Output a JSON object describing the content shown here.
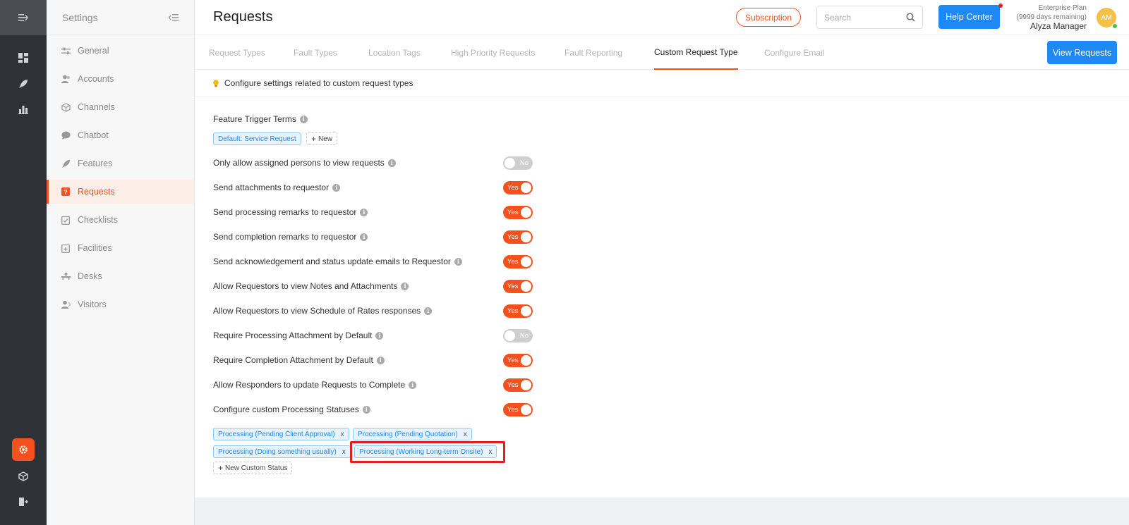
{
  "rail": {
    "icons": [
      "menu-expand-icon",
      "dashboard-icon",
      "rocket-icon",
      "analytics-icon",
      "settings-icon",
      "cube-icon",
      "logout-icon"
    ]
  },
  "sidebar": {
    "title": "Settings",
    "items": [
      {
        "label": "General",
        "icon": "sliders-icon"
      },
      {
        "label": "Accounts",
        "icon": "users-icon"
      },
      {
        "label": "Channels",
        "icon": "cube-icon"
      },
      {
        "label": "Chatbot",
        "icon": "chat-icon"
      },
      {
        "label": "Features",
        "icon": "rocket-icon"
      },
      {
        "label": "Requests",
        "icon": "question-icon"
      },
      {
        "label": "Checklists",
        "icon": "checklist-icon"
      },
      {
        "label": "Facilities",
        "icon": "calendar-plus-icon"
      },
      {
        "label": "Desks",
        "icon": "desk-icon"
      },
      {
        "label": "Visitors",
        "icon": "visitor-icon"
      }
    ]
  },
  "header": {
    "title": "Requests",
    "subscription_label": "Subscription",
    "search_placeholder": "Search",
    "help_label": "Help Center",
    "plan_name": "Enterprise Plan",
    "plan_remaining": "(9999 days remaining)",
    "user_name": "Alyza Manager",
    "avatar_initials": "AM"
  },
  "tabs": {
    "items": [
      "Request Types",
      "Fault Types",
      "Location Tags",
      "High Priority Requests",
      "Fault Reporting",
      "Custom Request Type",
      "Configure Email"
    ],
    "active": "Custom Request Type",
    "view_requests_label": "View Requests"
  },
  "info": {
    "text": "Configure settings related to custom request types"
  },
  "trigger": {
    "label": "Feature Trigger Terms",
    "chip": "Default: Service Request",
    "new_label": "New"
  },
  "settings": [
    {
      "label": "Only allow assigned persons to view requests",
      "state": "No"
    },
    {
      "label": "Send attachments to requestor",
      "state": "Yes"
    },
    {
      "label": "Send processing remarks to requestor",
      "state": "Yes"
    },
    {
      "label": "Send completion remarks to requestor",
      "state": "Yes"
    },
    {
      "label": "Send acknowledgement and status update emails to Requestor",
      "state": "Yes"
    },
    {
      "label": "Allow Requestors to view Notes and Attachments",
      "state": "Yes"
    },
    {
      "label": "Allow Requestors to view Schedule of Rates responses",
      "state": "Yes"
    },
    {
      "label": "Require Processing Attachment by Default",
      "state": "No"
    },
    {
      "label": "Require Completion Attachment by Default",
      "state": "Yes"
    },
    {
      "label": "Allow Responders to update Requests to Complete",
      "state": "Yes"
    },
    {
      "label": "Configure custom Processing Statuses",
      "state": "Yes"
    }
  ],
  "statuses": [
    "Processing (Pending Client Approval)",
    "Processing (Pending Quotation)",
    "Processing (Doing something usually)",
    "Processing (Working Long-term Onsite)"
  ],
  "new_status_label": "New Custom Status",
  "remove_symbol": "x",
  "colors": {
    "accent": "#f4511e",
    "primary": "#1e88f5",
    "highlight": "#e02020"
  }
}
